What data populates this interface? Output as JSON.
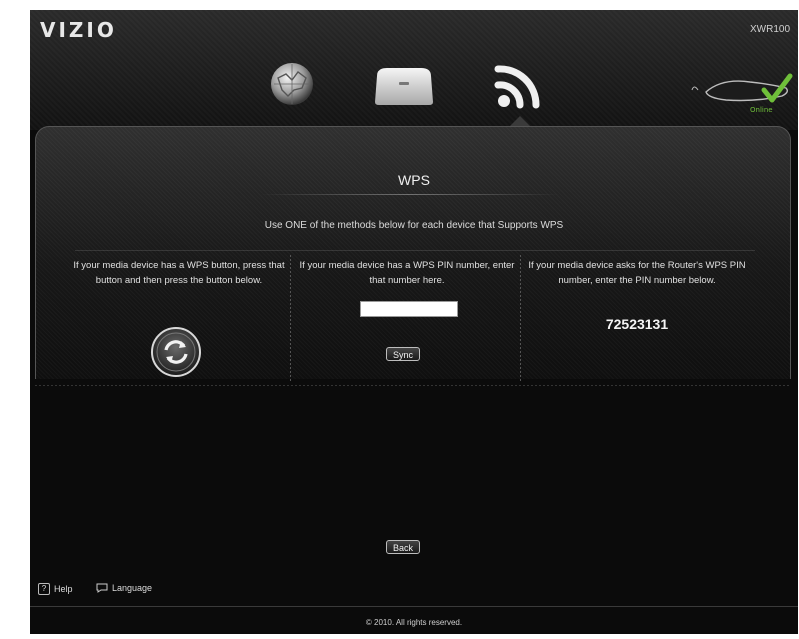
{
  "header": {
    "logo": "VIZIO",
    "model": "XWR100",
    "online_status": "Online"
  },
  "nav": {
    "icons": [
      "globe-icon",
      "router-icon",
      "wifi-icon"
    ],
    "active": "wifi-icon"
  },
  "panel": {
    "title": "WPS",
    "instructions": "Use ONE of the methods below for each device that Supports WPS"
  },
  "methods": {
    "push_button_text": "If your media device has a WPS button, press that button and then press the button below.",
    "device_pin_text": "If your media device has a WPS PIN number, enter that number here.",
    "device_pin_value": "",
    "sync_label": "Sync",
    "router_pin_text": "If your media device asks for the Router's WPS PIN number, enter the PIN number below.",
    "router_pin": "72523131"
  },
  "actions": {
    "back_label": "Back"
  },
  "footer": {
    "help_label": "Help",
    "help_icon_glyph": "?",
    "language_label": "Language",
    "copyright": "© 2010. All rights reserved."
  },
  "colors": {
    "background": "#0b0b0b",
    "accent_online": "#6fbf3a",
    "text": "#e8e8e8"
  }
}
